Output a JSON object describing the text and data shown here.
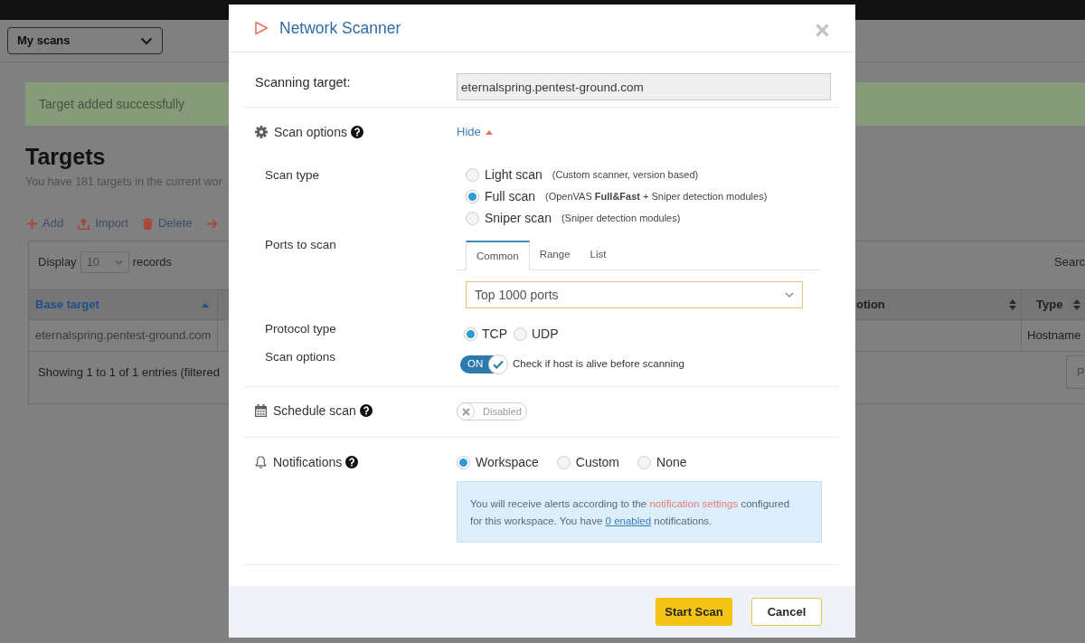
{
  "page": {
    "workspace_select": {
      "value": "My scans"
    },
    "alert": "Target added successfully",
    "heading": "Targets",
    "subtitle": "You have 181 targets in the current wor",
    "actions": [
      {
        "kind": "add",
        "label": "Add"
      },
      {
        "kind": "import",
        "label": "Import"
      },
      {
        "kind": "delete",
        "label": "Delete"
      },
      {
        "kind": "move"
      }
    ],
    "table": {
      "display_label": "Display",
      "page_size": "10",
      "records_label": "records",
      "search_label": "Searc",
      "columns": [
        {
          "label": "Base target",
          "sorted": true
        },
        {
          "label": "otion",
          "sorted": false
        },
        {
          "label": "Type",
          "sorted": false
        }
      ],
      "rows": [
        {
          "base_target": "eternalspring.pentest-ground.com",
          "type": "Hostname"
        }
      ],
      "info": "Showing 1 to 1 of 1 entries (filtered",
      "pagination_button": "P"
    }
  },
  "modal": {
    "title": "Network Scanner",
    "target": {
      "label": "Scanning target:",
      "value": "eternalspring.pentest-ground.com"
    },
    "scan_options": {
      "label": "Scan options",
      "toggle_label": "Hide",
      "expanded": true,
      "scan_type": {
        "label": "Scan type",
        "options": [
          {
            "label": "Light scan",
            "note": "(Custom scanner, version based)",
            "selected": false
          },
          {
            "label": "Full scan",
            "note": "(OpenVAS **Full&Fast** + Sniper detection modules)",
            "selected": true
          },
          {
            "label": "Sniper scan",
            "note": "(Sniper detection modules)",
            "selected": false
          }
        ]
      },
      "ports": {
        "label": "Ports to scan",
        "tabs": [
          {
            "label": "Common",
            "selected": true
          },
          {
            "label": "Range",
            "selected": false
          },
          {
            "label": "List",
            "selected": false
          }
        ],
        "value": "Top 1000 ports"
      },
      "protocol": {
        "label": "Protocol type",
        "options": [
          {
            "label": "TCP",
            "selected": true
          },
          {
            "label": "UDP",
            "selected": false
          }
        ]
      },
      "options": {
        "label": "Scan options",
        "on": true,
        "switch_text": "ON",
        "description": "Check if host is alive before scanning"
      }
    },
    "schedule": {
      "label": "Schedule scan",
      "on": false,
      "switch_text": "Disabled"
    },
    "notifications": {
      "label": "Notifications",
      "options": [
        {
          "label": "Workspace",
          "selected": true
        },
        {
          "label": "Custom",
          "selected": false
        },
        {
          "label": "None",
          "selected": false
        }
      ],
      "info": [
        {
          "kind": "plain",
          "text": "You will receive alerts according to the "
        },
        {
          "kind": "link",
          "text": "notification settings"
        },
        {
          "kind": "plain",
          "text": " configured for this workspace. You have "
        },
        {
          "kind": "count_link",
          "text": "0 enabled"
        },
        {
          "kind": "plain",
          "text": " notifications."
        }
      ]
    },
    "buttons": [
      {
        "kind": "primary",
        "label": "Start Scan"
      },
      {
        "kind": "secondary",
        "label": "Cancel"
      }
    ]
  }
}
